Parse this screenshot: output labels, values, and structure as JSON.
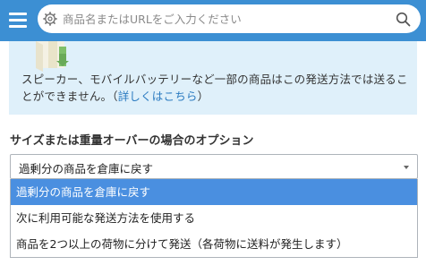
{
  "header": {
    "search_placeholder": "商品名またはURLをご入力ください",
    "icons": [
      "menu-icon",
      "gear-icon",
      "search-icon"
    ],
    "colors": {
      "bar": "#3c8fd3"
    }
  },
  "info": {
    "text": "スピーカー、モバイルバッテリーなど一部の商品はこの発送方法では送ることができません。（",
    "link": "詳しくはこちら",
    "close": "）",
    "colors": {
      "background": "#dff0fa",
      "link": "#2a7ac0"
    }
  },
  "options_section": {
    "title": "サイズまたは重量オーバーの場合のオプション",
    "selected_value": "過剰分の商品を倉庫に戻す",
    "options": [
      "過剰分の商品を倉庫に戻す",
      "次に利用可能な発送方法を使用する",
      "商品を2つ以上の荷物に分けて発送（各荷物に送料が発生します）"
    ],
    "highlight_color": "#4a8fe0"
  }
}
